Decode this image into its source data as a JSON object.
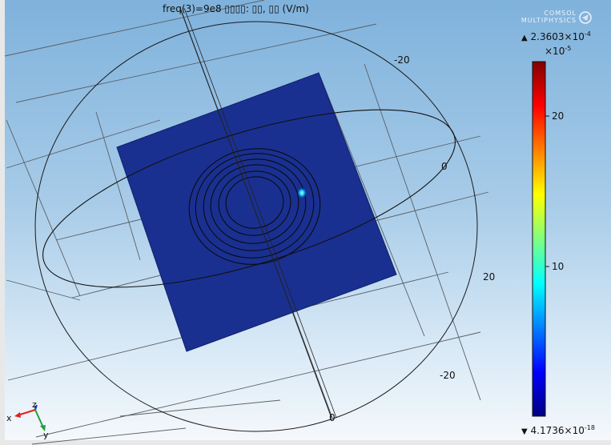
{
  "title": "freq(3)=9e8   ▯▯▯▯: ▯▯, ▯▯ (V/m)",
  "logo": {
    "line1": "COMSOL",
    "line2": "MULTIPHYSICS"
  },
  "axis_labels": {
    "y_minus_20": "-20",
    "x_zero": "0",
    "x_20": "20",
    "x_minus_20": "-20",
    "bottom_zero": "0"
  },
  "triad": {
    "x": "x",
    "y": "y",
    "z": "z"
  },
  "colorbar": {
    "max_label": "2.3603×10",
    "max_exp": "-4",
    "scale_label": "×10",
    "scale_exp": "-5",
    "tick_20": "20",
    "tick_10": "10",
    "min_label": "4.1736×10",
    "min_exp": "-18",
    "up_arrow": "▲",
    "down_arrow": "▼",
    "colors": [
      "#800000",
      "#ff0000",
      "#ff8000",
      "#ffff00",
      "#80ff80",
      "#00ffff",
      "#0080ff",
      "#0000ff",
      "#000080"
    ]
  },
  "colors": {
    "surface": "#1a3090",
    "line": "#111111"
  }
}
